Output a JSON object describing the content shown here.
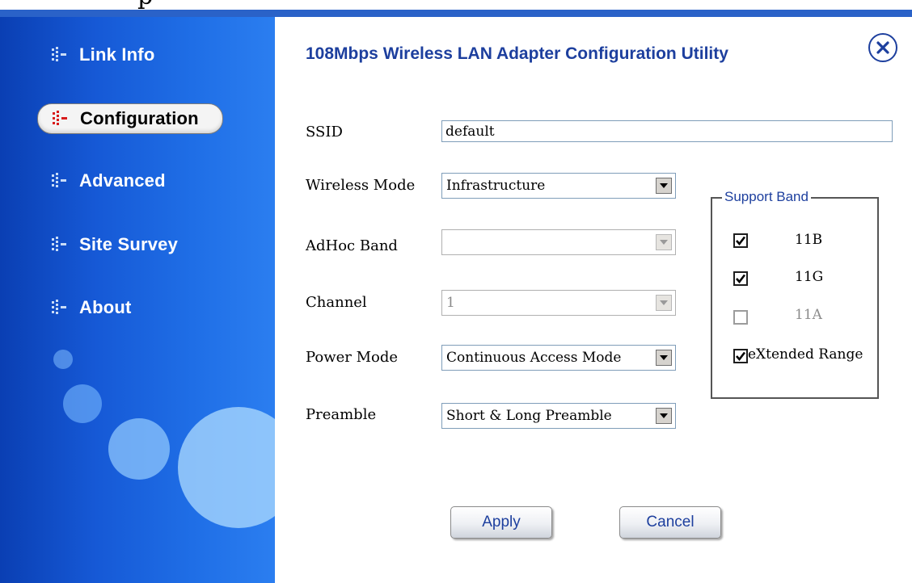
{
  "app_title": "108Mbps Wireless LAN Adapter Configuration Utility",
  "sidebar": {
    "items": [
      {
        "label": "Link Info",
        "icon": "bars-icon",
        "active": false
      },
      {
        "label": "Configuration",
        "icon": "bars-icon",
        "active": true
      },
      {
        "label": "Advanced",
        "icon": "bars-icon",
        "active": false
      },
      {
        "label": "Site Survey",
        "icon": "bars-icon",
        "active": false
      },
      {
        "label": "About",
        "icon": "bars-icon",
        "active": false
      }
    ]
  },
  "form": {
    "ssid": {
      "label": "SSID",
      "value": "default"
    },
    "wireless_mode": {
      "label": "Wireless Mode",
      "value": "Infrastructure"
    },
    "adhoc_band": {
      "label": "AdHoc Band",
      "value": "",
      "disabled": true
    },
    "channel": {
      "label": "Channel",
      "value": "1",
      "disabled": true
    },
    "power_mode": {
      "label": "Power Mode",
      "value": "Continuous Access Mode"
    },
    "preamble": {
      "label": "Preamble",
      "value": "Short & Long Preamble"
    }
  },
  "support_band": {
    "title": "Support Band",
    "options": [
      {
        "label": "11B",
        "checked": true,
        "disabled": false
      },
      {
        "label": "11G",
        "checked": true,
        "disabled": false
      },
      {
        "label": "11A",
        "checked": false,
        "disabled": true
      },
      {
        "label": "eXtended Range",
        "checked": true,
        "disabled": false
      }
    ]
  },
  "buttons": {
    "apply": "Apply",
    "cancel": "Cancel"
  },
  "colors": {
    "accent": "#1d3f9e",
    "sidebar_blue": "#1659d6",
    "top_bar": "#2a62c8"
  }
}
